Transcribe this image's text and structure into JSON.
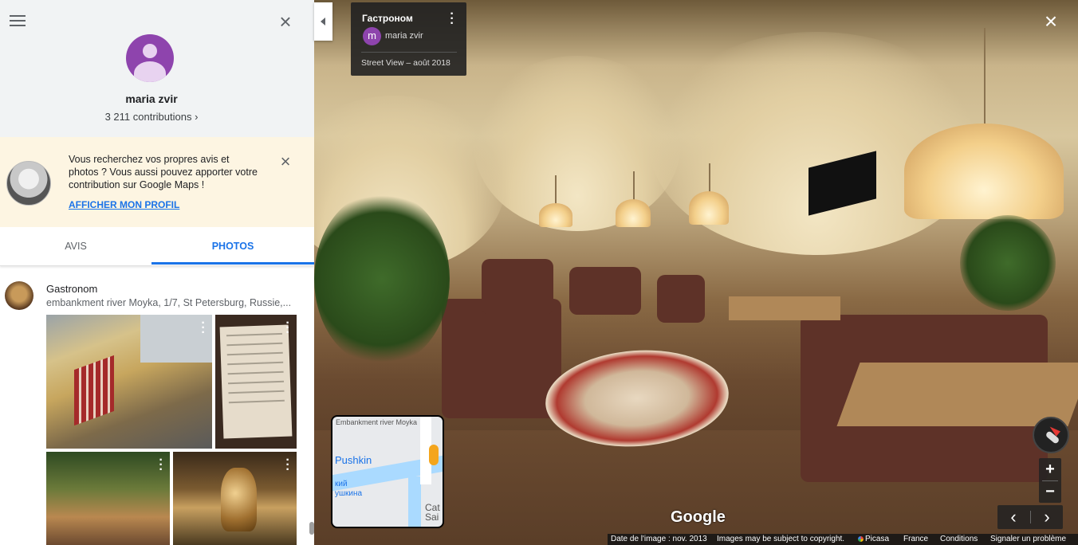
{
  "profile": {
    "name": "maria zvir",
    "contributions": "3 211 contributions ›"
  },
  "promo": {
    "text": "Vous recherchez vos propres avis et photos ? Vous aussi pouvez apporter votre contribution sur Google Maps !",
    "link": "AFFICHER MON PROFIL"
  },
  "tabs": [
    {
      "label": "AVIS",
      "active": false
    },
    {
      "label": "PHOTOS",
      "active": true
    }
  ],
  "place": {
    "name": "Gastronom",
    "address": "embankment river Moyka, 1/7, St Petersburg, Russie,..."
  },
  "info_card": {
    "title": "Гастроном",
    "avatar_letter": "m",
    "user": "maria zvir",
    "date": "Street View – août 2018"
  },
  "minimap": {
    "label_road": "Embankment river Moyka",
    "label_pushkin": "Pushkin",
    "label_cyrillic": "кий\nушкина",
    "label_cat": "Cat\nSai"
  },
  "brand": "Google",
  "footer": {
    "image_date": "Date de l'image : nov. 2013",
    "copyright": "Images may be subject to copyright.",
    "picasa": "Picasa",
    "country": "France",
    "terms": "Conditions",
    "report": "Signaler un problème"
  },
  "icons": {
    "menu": "hamburger-icon",
    "close": "close-icon",
    "more": "more-vert-icon",
    "zoom_in": "+",
    "zoom_out": "−",
    "prev": "‹",
    "next": "›"
  },
  "colors": {
    "accent": "#1a73e8",
    "avatar": "#8e44ad",
    "promo_bg": "#fdf5e2",
    "header_bg": "#f1f3f4"
  }
}
